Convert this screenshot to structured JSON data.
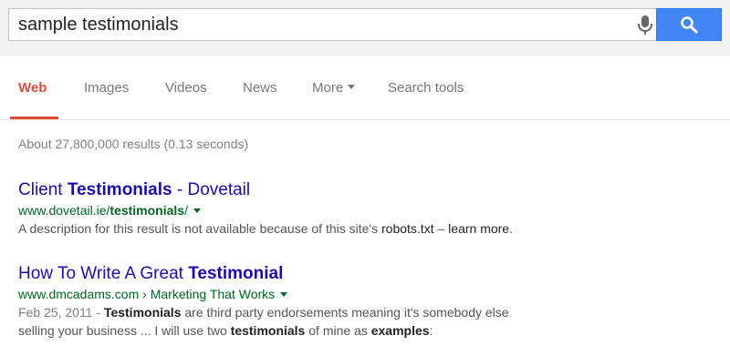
{
  "search": {
    "query": "sample testimonials"
  },
  "tabs": [
    {
      "label": "Web"
    },
    {
      "label": "Images"
    },
    {
      "label": "Videos"
    },
    {
      "label": "News"
    },
    {
      "label": "More"
    },
    {
      "label": "Search tools"
    }
  ],
  "stats": "About 27,800,000 results (0.13 seconds)",
  "results": [
    {
      "title_pre": "Client ",
      "title_bold": "Testimonials",
      "title_post": " - Dovetail",
      "url_pre": "www.dovetail.ie/",
      "url_bold": "testimonials",
      "url_post": "/",
      "snippet_pre": "A description for this result is not available because of this site's ",
      "snippet_link1": "robots.txt",
      "snippet_mid": " – ",
      "snippet_link2": "learn more",
      "snippet_end": "."
    },
    {
      "title_pre": "How To Write A Great ",
      "title_bold": "Testimonial",
      "url_host": "www.dmcadams.com",
      "url_sep": " › ",
      "url_path": "Marketing That Works",
      "date": "Feb 25, 2011",
      "date_sep": " - ",
      "s1_bold": "Testimonials",
      "s1_text": " are third party endorsements meaning it's somebody else",
      "s2_text": "selling your business ... I will use two ",
      "s2_bold1": "testimonials",
      "s2_mid": " of mine as ",
      "s2_bold2": "examples",
      "s2_end": ":"
    }
  ],
  "colors": {
    "accent_red": "#dd4b39",
    "search_blue": "#4285f4",
    "link_blue": "#1a0dab",
    "url_green": "#006621"
  }
}
